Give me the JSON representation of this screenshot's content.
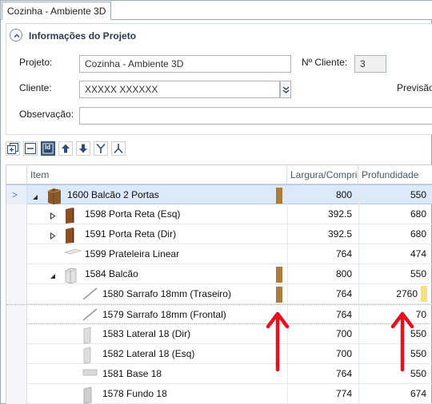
{
  "window": {
    "tab_label": "Cozinha - Ambiente 3D"
  },
  "panel": {
    "title": "Informações do Projeto",
    "projeto_label": "Projeto:",
    "projeto_value": "Cozinha - Ambiente 3D",
    "nocliente_label": "Nº Cliente:",
    "nocliente_value": "3",
    "cliente_label": "Cliente:",
    "cliente_value": "XXXXX XXXXXX",
    "previsao_label": "Previsão",
    "observacao_label": "Observação:",
    "observacao_value": ""
  },
  "toolbar": {
    "buttons": [
      "expand-all-icon",
      "collapse-all-icon",
      "id-icon",
      "arrow-up-icon",
      "arrow-down-icon",
      "merge-icon",
      "split-icon"
    ],
    "id_label": "Id"
  },
  "grid": {
    "columns": [
      "Item",
      "Largura/Compri",
      "Profundidade"
    ],
    "rows": [
      {
        "id": "1600",
        "name": "Balcão 2 Portas",
        "largura": "800",
        "profundidade": "550",
        "level": 0,
        "expander": "expanded",
        "icon": "cabinet-icon",
        "selected": true,
        "brown_bar": true
      },
      {
        "id": "1598",
        "name": "Porta Reta (Esq)",
        "largura": "392.5",
        "profundidade": "680",
        "level": 1,
        "expander": "collapsed",
        "icon": "door-icon"
      },
      {
        "id": "1591",
        "name": "Porta Reta (Dir)",
        "largura": "392.5",
        "profundidade": "680",
        "level": 1,
        "expander": "collapsed",
        "icon": "door-icon"
      },
      {
        "id": "1599",
        "name": "Prateleira Linear",
        "largura": "764",
        "profundidade": "474",
        "level": 1,
        "expander": "none",
        "icon": "shelf-icon"
      },
      {
        "id": "1584",
        "name": "Balcão",
        "largura": "800",
        "profundidade": "550",
        "level": 1,
        "expander": "expanded",
        "icon": "cabinet-grey-icon",
        "brown_bar": true
      },
      {
        "id": "1580",
        "name": "Sarrafo 18mm (Traseiro)",
        "largura": "764",
        "profundidade": "2760",
        "level": 2,
        "expander": "none",
        "icon": "batten-icon",
        "brown_bar": true,
        "yellow_bar": true
      },
      {
        "id": "1579",
        "name": "Sarrafo 18mm (Frontal)",
        "largura": "764",
        "profundidade": "70",
        "level": 2,
        "expander": "none",
        "icon": "batten-icon",
        "focus": true
      },
      {
        "id": "1583",
        "name": "Lateral 18 (Dir)",
        "largura": "700",
        "profundidade": "550",
        "level": 2,
        "expander": "none",
        "icon": "panel-icon"
      },
      {
        "id": "1582",
        "name": "Lateral 18 (Esq)",
        "largura": "700",
        "profundidade": "550",
        "level": 2,
        "expander": "none",
        "icon": "panel-icon"
      },
      {
        "id": "1581",
        "name": "Base 18",
        "largura": "764",
        "profundidade": "550",
        "level": 2,
        "expander": "none",
        "icon": "base-icon"
      },
      {
        "id": "1578",
        "name": "Fundo 18",
        "largura": "774",
        "profundidade": "674",
        "level": 2,
        "expander": "none",
        "icon": "back-panel-icon"
      }
    ]
  },
  "colors": {
    "accent": "#3c5f85",
    "selection": "#dce9f8",
    "wood": "#b07a3a",
    "highlight_yellow": "#f7e08a",
    "annotation_red": "#e8101e"
  }
}
